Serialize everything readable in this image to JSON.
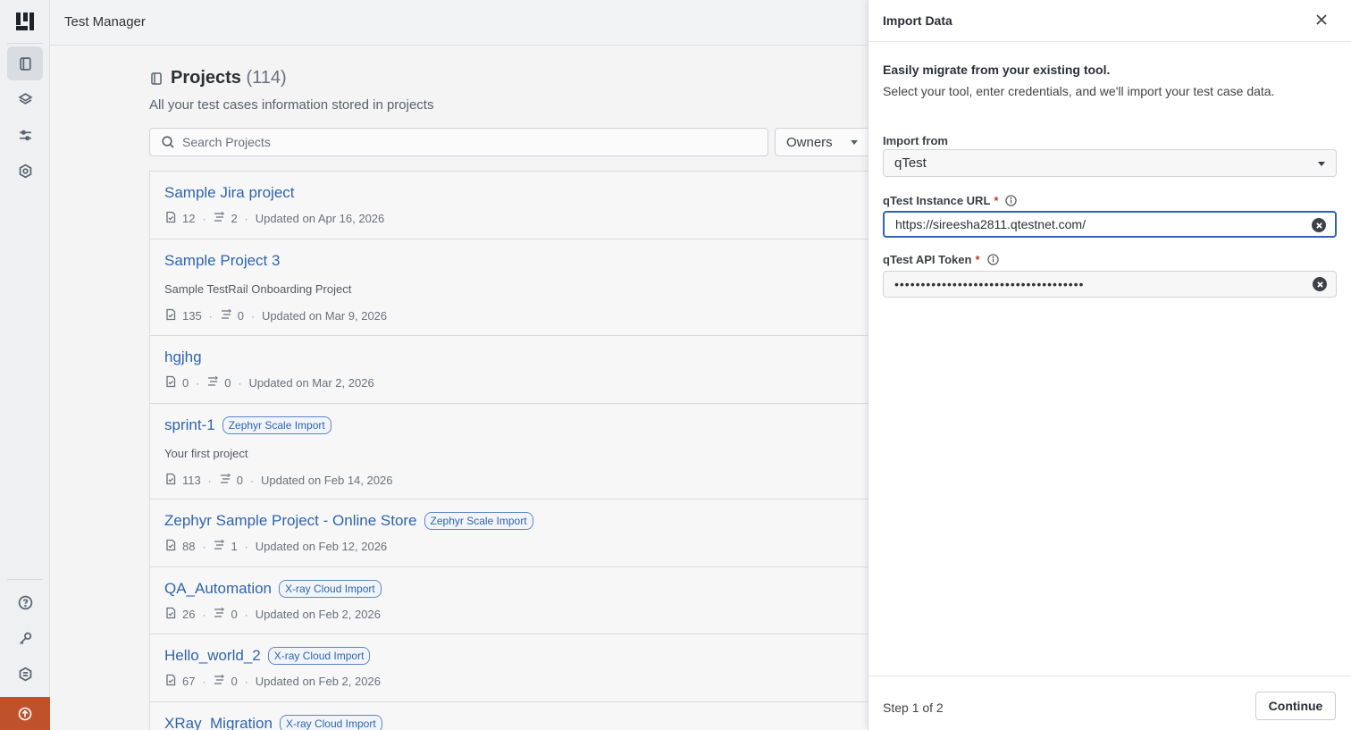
{
  "app": {
    "title": "Test Manager"
  },
  "projects": {
    "heading": "Projects",
    "count": "(114)",
    "subtitle": "All your test cases information stored in projects",
    "search_placeholder": "Search Projects",
    "owners_label": "Owners",
    "items": [
      {
        "name": "Sample Jira project",
        "badge": "",
        "description": "",
        "cases": "12",
        "runs": "2",
        "updated": "Updated on Apr 16, 2026"
      },
      {
        "name": "Sample Project 3",
        "badge": "",
        "description": "Sample TestRail Onboarding Project",
        "cases": "135",
        "runs": "0",
        "updated": "Updated on Mar 9, 2026"
      },
      {
        "name": "hgjhg",
        "badge": "",
        "description": "",
        "cases": "0",
        "runs": "0",
        "updated": "Updated on Mar 2, 2026"
      },
      {
        "name": "sprint-1",
        "badge": "Zephyr Scale Import",
        "description": "Your first project",
        "cases": "113",
        "runs": "0",
        "updated": "Updated on Feb 14, 2026"
      },
      {
        "name": "Zephyr Sample Project - Online Store",
        "badge": "Zephyr Scale Import",
        "description": "",
        "cases": "88",
        "runs": "1",
        "updated": "Updated on Feb 12, 2026"
      },
      {
        "name": "QA_Automation",
        "badge": "X-ray Cloud Import",
        "description": "",
        "cases": "26",
        "runs": "0",
        "updated": "Updated on Feb 2, 2026"
      },
      {
        "name": "Hello_world_2",
        "badge": "X-ray Cloud Import",
        "description": "",
        "cases": "67",
        "runs": "0",
        "updated": "Updated on Feb 2, 2026"
      },
      {
        "name": "XRay_Migration",
        "badge": "X-ray Cloud Import",
        "description": "",
        "cases": "",
        "runs": "",
        "updated": ""
      }
    ]
  },
  "drawer": {
    "title": "Import Data",
    "lead": "Easily migrate from your existing tool.",
    "lead_sub": "Select your tool, enter credentials, and we'll import your test case data.",
    "import_from_label": "Import from",
    "import_from_value": "qTest",
    "url_label": "qTest Instance URL",
    "url_value": "https://sireesha2811.qtestnet.com/",
    "token_label": "qTest API Token",
    "token_value": "••••••••••••••••••••••••••••••••••••",
    "required_mark": "*",
    "step": "Step 1 of 2",
    "continue_label": "Continue"
  },
  "icons": {
    "logo": "brand-logo",
    "rail": [
      "projects-icon",
      "layers-icon",
      "sliders-icon",
      "settings-icon",
      "help-icon",
      "key-icon",
      "integrations-icon",
      "upgrade-icon"
    ]
  },
  "colors": {
    "accent": "#2f64b0",
    "upgrade": "#c0522b",
    "required": "#c0392b"
  }
}
